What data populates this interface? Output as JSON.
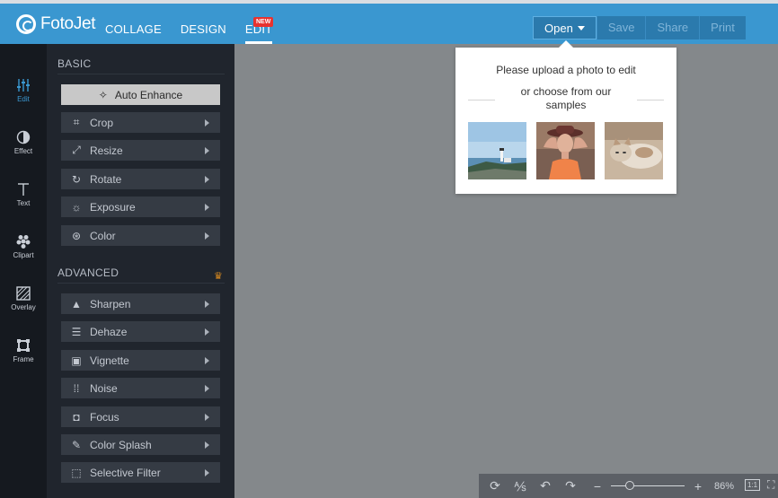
{
  "brand": {
    "name": "FotoJet"
  },
  "nav": {
    "items": [
      "COLLAGE",
      "DESIGN",
      "EDIT"
    ],
    "badge": "NEW"
  },
  "actions": {
    "open": "Open",
    "save": "Save",
    "share": "Share",
    "print": "Print"
  },
  "rail": [
    {
      "label": "Edit",
      "icon": "sliders-icon"
    },
    {
      "label": "Effect",
      "icon": "half-circle-icon"
    },
    {
      "label": "Text",
      "icon": "text-icon"
    },
    {
      "label": "Clipart",
      "icon": "clipart-icon"
    },
    {
      "label": "Overlay",
      "icon": "overlay-icon"
    },
    {
      "label": "Frame",
      "icon": "frame-icon"
    }
  ],
  "panel": {
    "basic_title": "BASIC",
    "auto_enhance": "Auto Enhance",
    "basic": [
      "Crop",
      "Resize",
      "Rotate",
      "Exposure",
      "Color"
    ],
    "advanced_title": "ADVANCED",
    "advanced": [
      "Sharpen",
      "Dehaze",
      "Vignette",
      "Noise",
      "Focus",
      "Color Splash",
      "Selective Filter"
    ]
  },
  "popup": {
    "title": "Please upload a photo to edit",
    "or_text": "or choose from our samples"
  },
  "bottombar": {
    "zoom": "86%",
    "ratio": "1:1"
  },
  "colors": {
    "accent": "#3a97d0",
    "canvas": "#84888b",
    "panel": "#20252d",
    "rail": "#15191f"
  }
}
